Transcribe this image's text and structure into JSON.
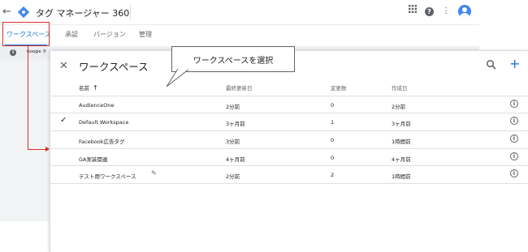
{
  "app": {
    "title": "タグ マネージャー 360",
    "back_icon": "arrow-back-icon",
    "colors": {
      "accent": "#1a73e8",
      "highlight": "#d93025",
      "logo": "#4285f4"
    }
  },
  "header_icons": [
    "apps-icon",
    "help-icon",
    "more-vert-icon",
    "account-avatar"
  ],
  "tabs": [
    {
      "label": "ワークスペース",
      "active": true
    },
    {
      "label": "承認",
      "active": false
    },
    {
      "label": "バージョン",
      "active": false
    },
    {
      "label": "管理",
      "active": false
    }
  ],
  "infobar": {
    "text": "Google タ"
  },
  "panel": {
    "title": "ワークスペース",
    "callout": "ワークスペースを選択",
    "columns": {
      "name": "名前",
      "updated": "最終更新日",
      "changes": "変更数",
      "created": "作成日"
    },
    "sort_icon": "arrow-upward-icon",
    "rows": [
      {
        "name": "AudienceOne",
        "updated": "2分前",
        "changes": "0",
        "created": "2分前",
        "selected": false
      },
      {
        "name": "Default Workspace",
        "updated": "3ヶ月前",
        "changes": "1",
        "created": "3ヶ月前",
        "selected": true
      },
      {
        "name": "Facebook広告タグ",
        "updated": "3分前",
        "changes": "0",
        "created": "1時間前",
        "selected": false
      },
      {
        "name": "GA実装関連",
        "updated": "4ヶ月前",
        "changes": "0",
        "created": "4ヶ月前",
        "selected": false
      },
      {
        "name": "テスト用ワークスペース",
        "updated": "2分前",
        "changes": "2",
        "created": "1時間前",
        "selected": false
      }
    ]
  }
}
